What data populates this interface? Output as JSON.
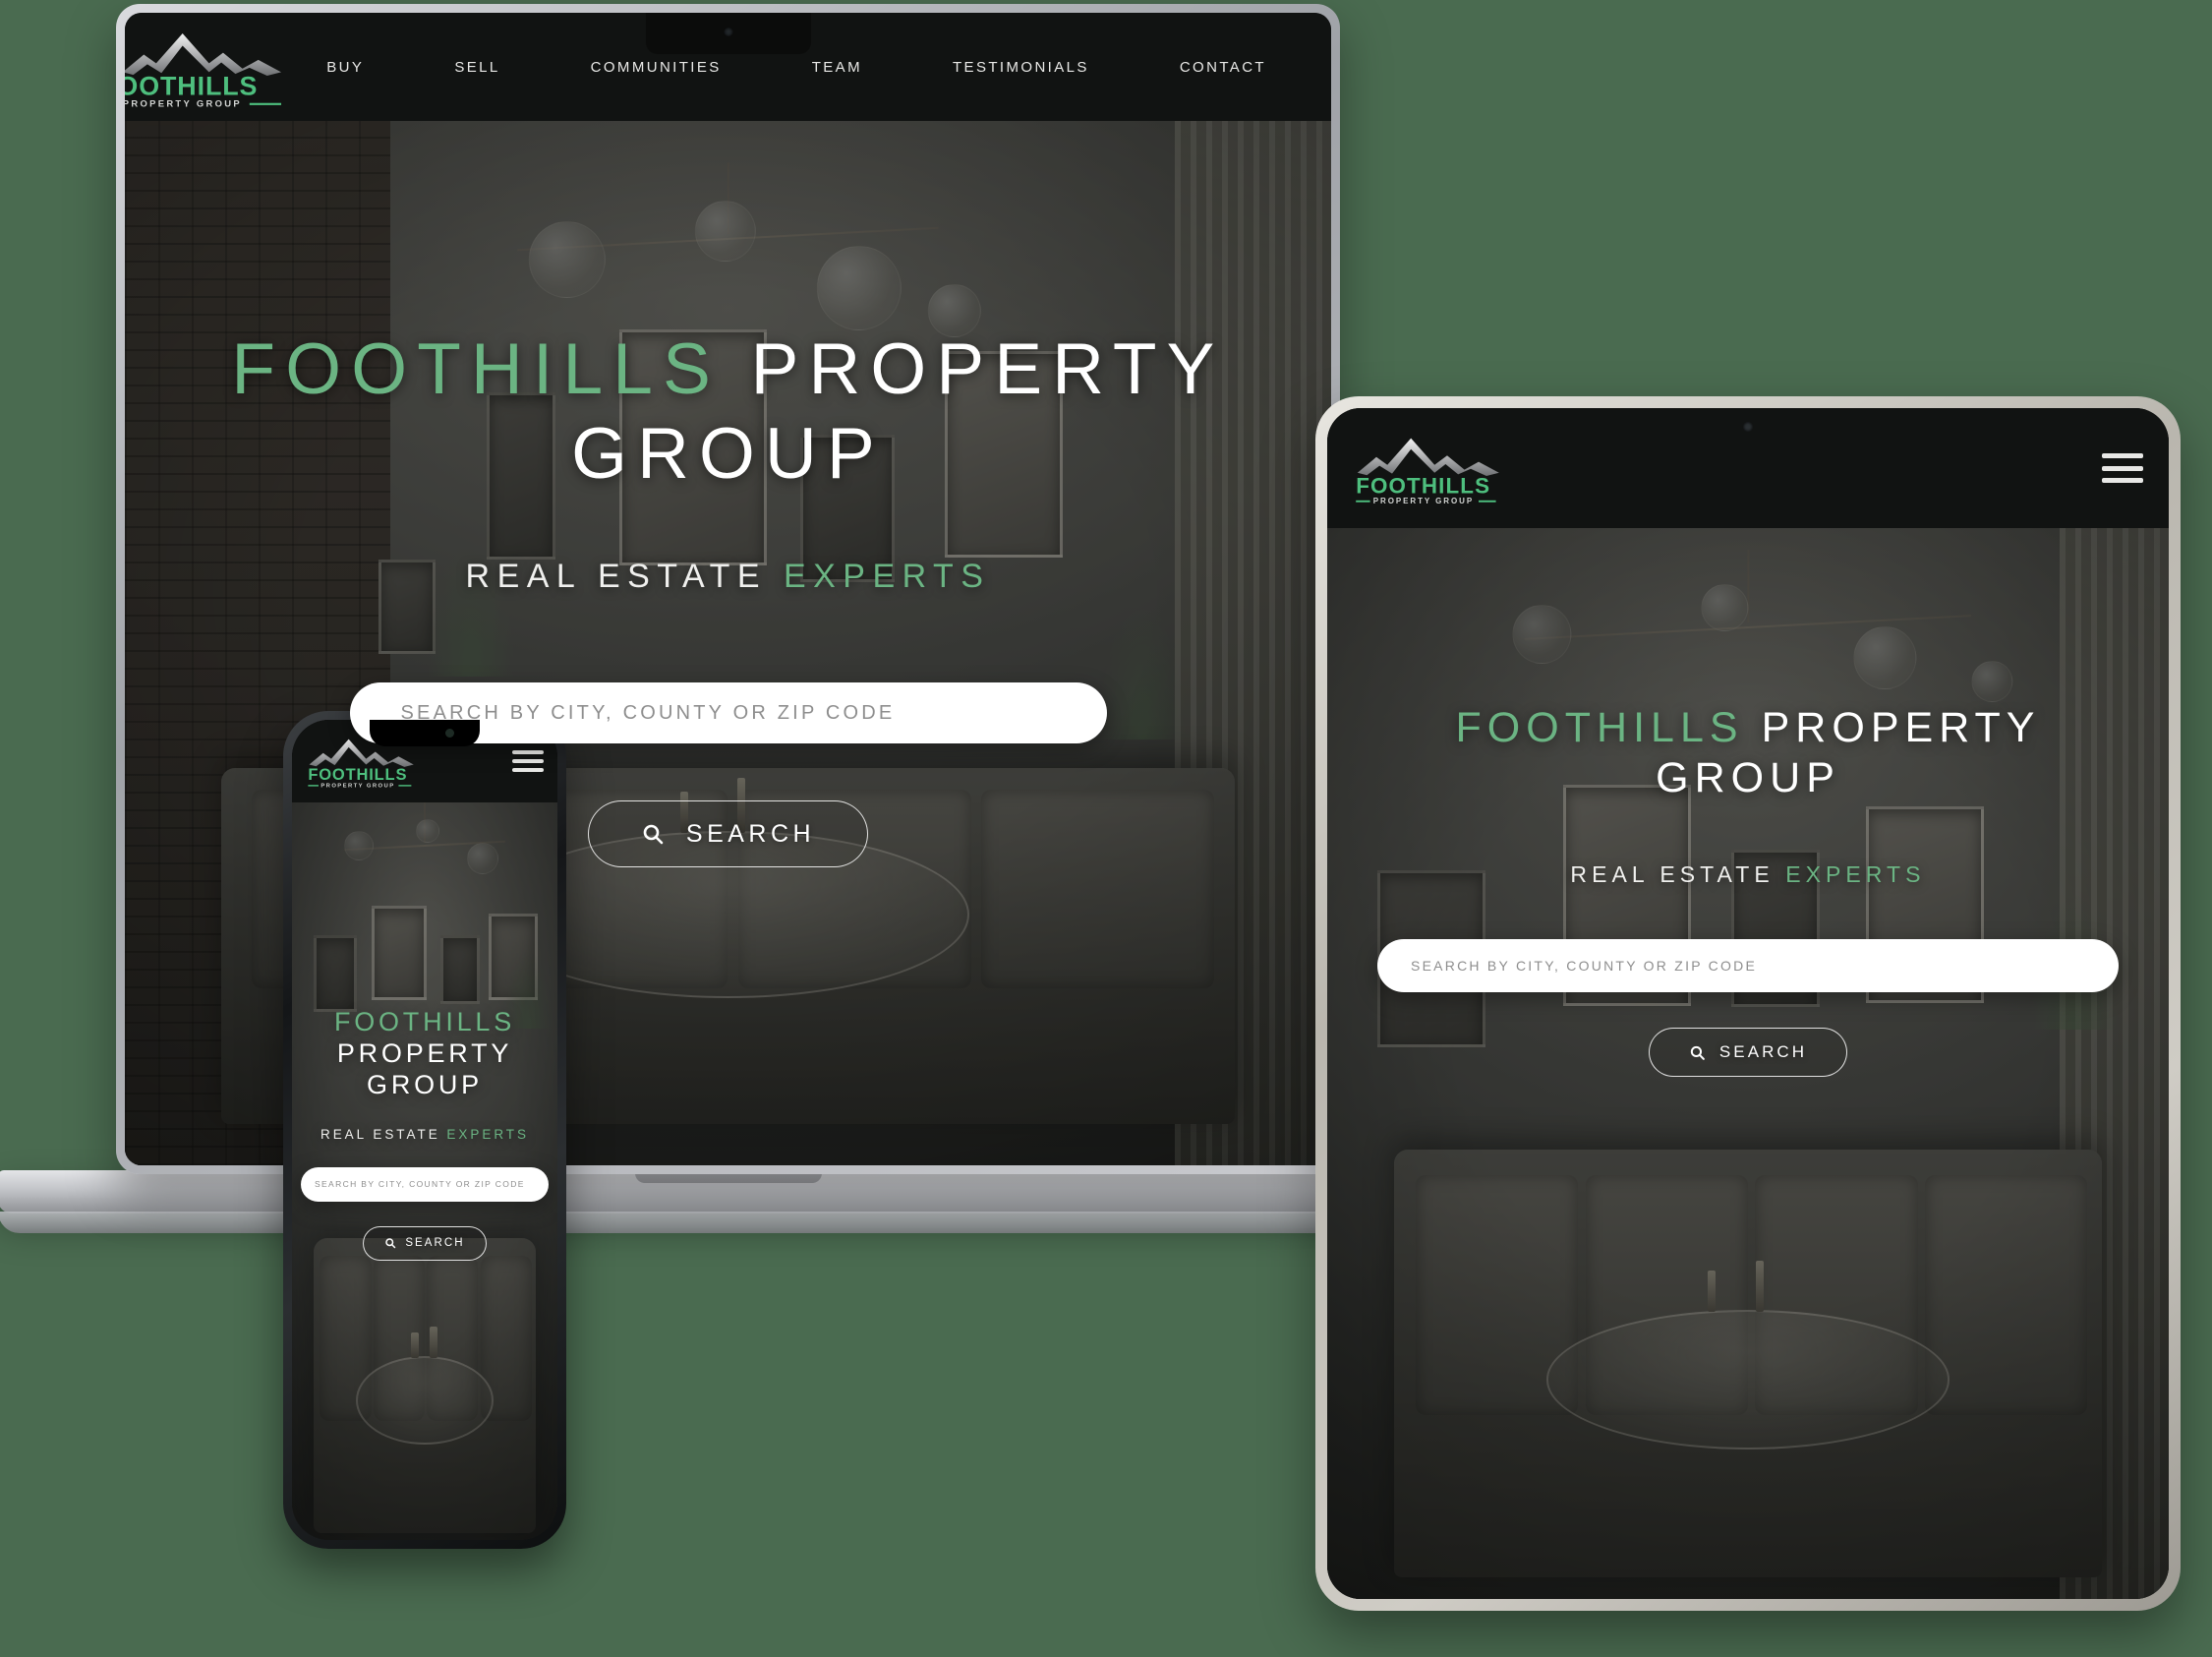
{
  "brand": {
    "name_primary": "FOOTHILLS",
    "name_secondary": "PROPERTY GROUP",
    "logo_partial_desktop": "OOTHILLS",
    "accent_color": "#6bb483",
    "dark_color": "#111312",
    "page_background": "#4a6b50"
  },
  "nav": {
    "items": [
      {
        "label": "BUY"
      },
      {
        "label": "SELL"
      },
      {
        "label": "COMMUNITIES"
      },
      {
        "label": "TEAM"
      },
      {
        "label": "TESTIMONIALS"
      },
      {
        "label": "CONTACT"
      }
    ],
    "menu_icon": "hamburger-icon"
  },
  "hero": {
    "title_accent": "FOOTHILLS",
    "title_rest": "PROPERTY GROUP",
    "title_rest_line1": "PROPERTY",
    "title_rest_line2": "GROUP",
    "subtitle_white": "REAL ESTATE",
    "subtitle_accent": "EXPERTS",
    "search_placeholder": "SEARCH BY CITY, COUNTY OR ZIP CODE",
    "search_button_label": "SEARCH",
    "search_icon": "magnifier-icon"
  },
  "devices": {
    "laptop": {
      "name": "laptop-mockup"
    },
    "tablet": {
      "name": "tablet-mockup"
    },
    "phone": {
      "name": "phone-mockup"
    }
  }
}
